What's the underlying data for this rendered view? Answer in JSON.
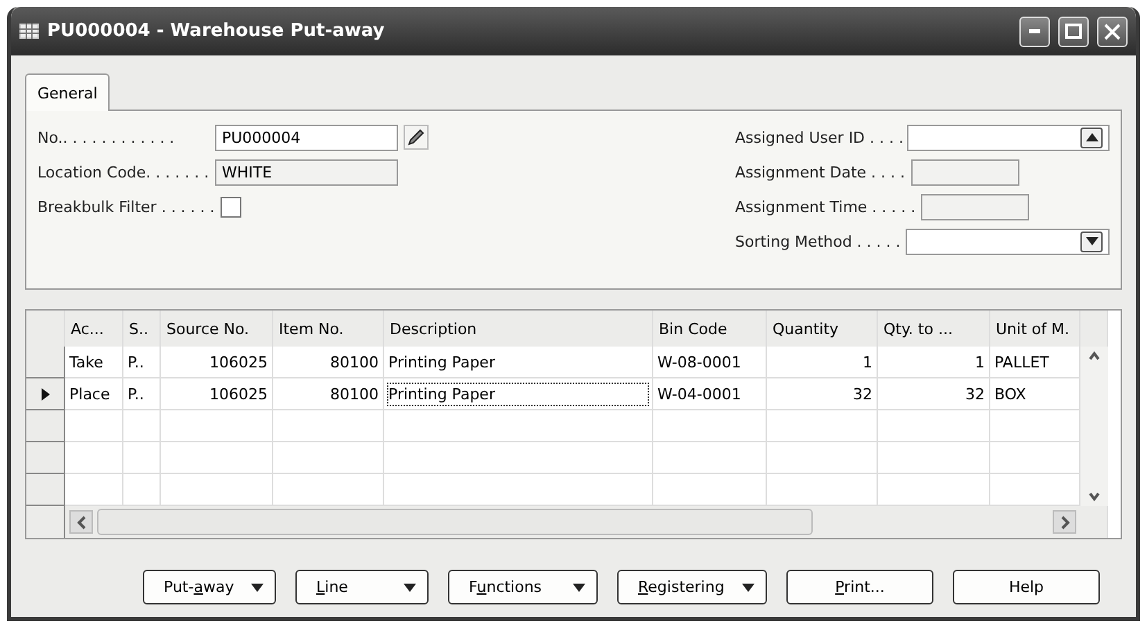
{
  "window": {
    "title": "PU000004 - Warehouse Put-away"
  },
  "tabs": [
    {
      "label": "General",
      "selected": true
    }
  ],
  "left_fields": [
    {
      "label": "No.. . . . . . . . . . . .",
      "value": "PU000004",
      "kind": "edit"
    },
    {
      "label": "Location Code. . . . . . .",
      "value": "WHITE",
      "kind": "readonly"
    },
    {
      "label": "Breakbulk Filter . . . . . .",
      "kind": "checkbox",
      "checked": false
    }
  ],
  "right_fields": [
    {
      "label": "Assigned User ID . . . .",
      "kind": "lookup"
    },
    {
      "label": "Assignment Date . . . .",
      "kind": "short"
    },
    {
      "label": "Assignment Time . . . . .",
      "kind": "short"
    },
    {
      "label": "Sorting Method . . . . .",
      "kind": "dropdown"
    }
  ],
  "table": {
    "columns": [
      {
        "label": "Ac...",
        "kind": "text"
      },
      {
        "label": "S..",
        "kind": "text"
      },
      {
        "label": "Source No.",
        "kind": "number"
      },
      {
        "label": "Item No.",
        "kind": "number"
      },
      {
        "label": "Description",
        "kind": "text"
      },
      {
        "label": "Bin Code",
        "kind": "text"
      },
      {
        "label": "Quantity",
        "kind": "number"
      },
      {
        "label": "Qty. to ...",
        "kind": "number"
      },
      {
        "label": "Unit of M.",
        "kind": "text"
      }
    ],
    "rows": [
      {
        "selected": false,
        "cells": [
          "Take",
          "P..",
          "106025",
          "80100",
          "Printing Paper",
          "W-08-0001",
          "1",
          "1",
          "PALLET"
        ]
      },
      {
        "selected": true,
        "cells": [
          "Place",
          "P..",
          "106025",
          "80100",
          "Printing Paper",
          "W-04-0001",
          "32",
          "32",
          "BOX"
        ]
      }
    ]
  },
  "buttons": [
    {
      "label_before": "Put-",
      "access_key": "a",
      "label_after": "way",
      "menu": true
    },
    {
      "access_key": "L",
      "label_after": "ine",
      "menu": true
    },
    {
      "label_before": "F",
      "access_key": "u",
      "label_after": "nctions",
      "menu": true
    },
    {
      "access_key": "R",
      "label_after": "egistering",
      "menu": true
    },
    {
      "access_key": "P",
      "label_after": "rint...",
      "menu": false
    },
    {
      "label_before": "Help",
      "menu": false
    }
  ]
}
